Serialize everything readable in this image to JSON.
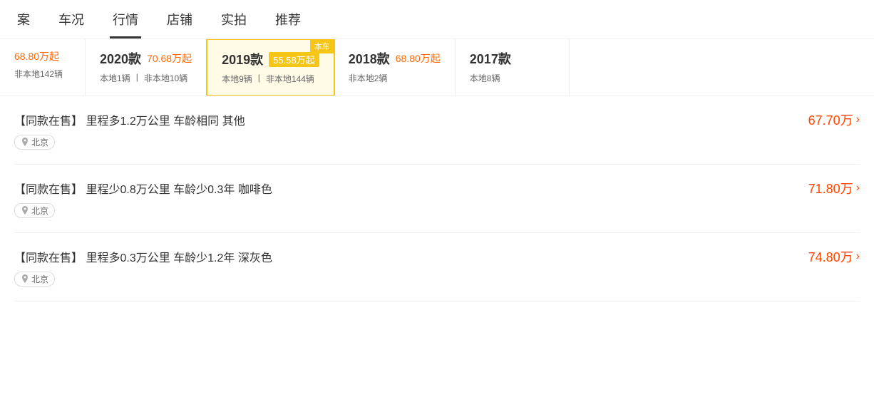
{
  "nav": {
    "tabs": [
      {
        "label": "案",
        "active": false
      },
      {
        "label": "车况",
        "active": false
      },
      {
        "label": "行情",
        "active": true
      },
      {
        "label": "店铺",
        "active": false
      },
      {
        "label": "实拍",
        "active": false
      },
      {
        "label": "推荐",
        "active": false
      }
    ]
  },
  "yearCards": [
    {
      "year": "2020款",
      "price": "70.68万起",
      "priceHighlight": false,
      "localCount": "本地1辆",
      "nonLocalCount": "非本地10辆",
      "active": false,
      "banche": false
    },
    {
      "year": "2019款",
      "price": "55.58万起",
      "priceHighlight": true,
      "localCount": "本地9辆",
      "nonLocalCount": "非本地144辆",
      "active": true,
      "banche": true,
      "bancheLabel": "本车"
    },
    {
      "year": "2018款",
      "price": "68.80万起",
      "priceHighlight": false,
      "localCount": "",
      "nonLocalCount": "非本地2辆",
      "active": false,
      "banche": false
    },
    {
      "year": "2017款",
      "price": "",
      "priceHighlight": false,
      "localCount": "本地8辆",
      "nonLocalCount": "",
      "active": false,
      "banche": false
    }
  ],
  "prevCard": {
    "price": "68.80万起",
    "nonLocalCount": "非本地142辆"
  },
  "listings": [
    {
      "tag": "【同款在售】",
      "desc": "里程多1.2万公里 车龄相同 其他",
      "price": "67.70万",
      "location": "北京"
    },
    {
      "tag": "【同款在售】",
      "desc": "里程少0.8万公里 车龄少0.3年 咖啡色",
      "price": "71.80万",
      "location": "北京"
    },
    {
      "tag": "【同款在售】",
      "desc": "里程多0.3万公里 车龄少1.2年 深灰色",
      "price": "74.80万",
      "location": "北京"
    }
  ]
}
